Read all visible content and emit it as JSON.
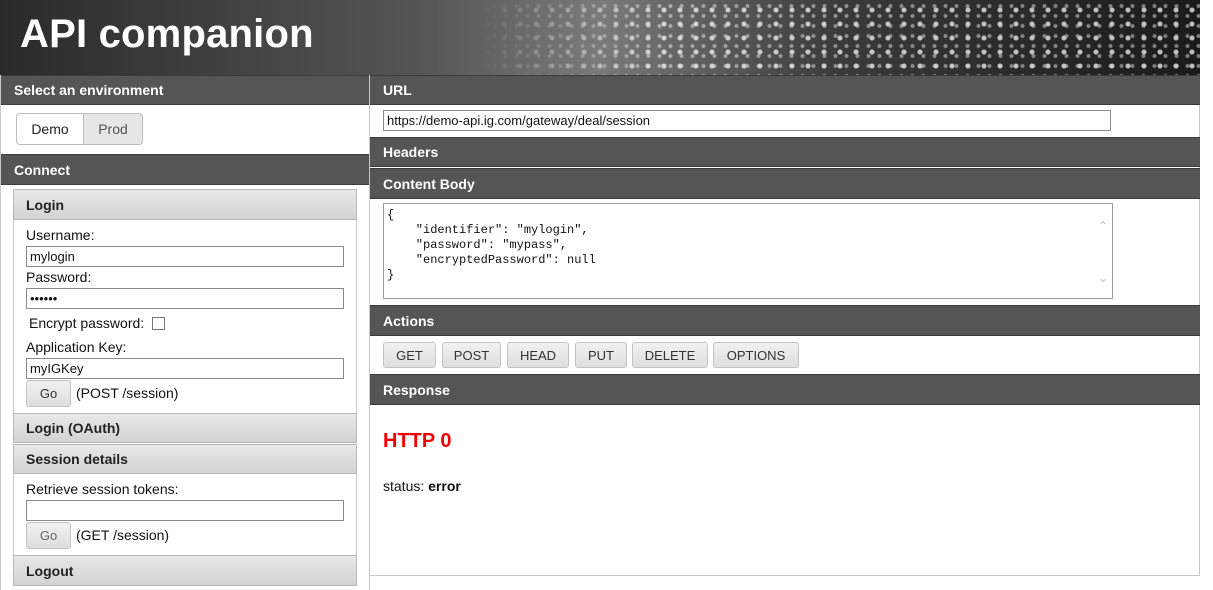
{
  "header": {
    "title": "API companion"
  },
  "environment": {
    "heading": "Select an environment",
    "options": [
      "Demo",
      "Prod"
    ],
    "selected": "Demo"
  },
  "connect": {
    "heading": "Connect",
    "login": {
      "heading": "Login",
      "username_label": "Username:",
      "username_value": "mylogin",
      "password_label": "Password:",
      "password_value": "mypass",
      "encrypt_label": "Encrypt password:",
      "app_key_label": "Application Key:",
      "app_key_value": "myIGKey",
      "go_label": "Go",
      "go_note": "(POST /session)"
    },
    "oauth": {
      "heading": "Login (OAuth)"
    },
    "session": {
      "heading": "Session details",
      "retrieve_label": "Retrieve session tokens:",
      "tokens_value": "",
      "go_label": "Go",
      "go_note": "(GET /session)"
    },
    "logout": {
      "heading": "Logout"
    }
  },
  "url": {
    "heading": "URL",
    "value": "https://demo-api.ig.com/gateway/deal/session"
  },
  "headers": {
    "heading": "Headers"
  },
  "content_body": {
    "heading": "Content Body",
    "text": "{\n    \"identifier\": \"mylogin\",\n    \"password\": \"mypass\",\n    \"encryptedPassword\": null\n}"
  },
  "actions": {
    "heading": "Actions",
    "buttons": [
      "GET",
      "POST",
      "HEAD",
      "PUT",
      "DELETE",
      "OPTIONS"
    ]
  },
  "response": {
    "heading": "Response",
    "http": "HTTP 0",
    "status_label": "status:",
    "status_value": "error"
  },
  "icons": {
    "scroll_up": "chevron-up-icon",
    "scroll_down": "chevron-down-icon"
  },
  "colors": {
    "panel_header": "#555555",
    "http_status": "#ee0000"
  }
}
